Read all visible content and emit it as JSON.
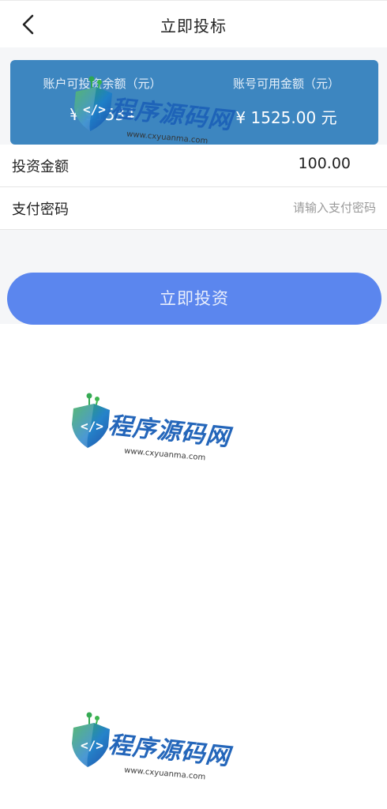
{
  "nav": {
    "title": "立即投标",
    "back_icon": "chevron-left-icon"
  },
  "balance_card": {
    "bg_color": "#3d86c0",
    "left": {
      "label": "账户可投资余额（元）",
      "value": "¥ 91534"
    },
    "right": {
      "label": "账号可用金额（元）",
      "value": "¥ 1525.00 元"
    }
  },
  "form": {
    "amount": {
      "label": "投资金额",
      "value": "100.00"
    },
    "password": {
      "label": "支付密码",
      "placeholder": "请输入支付密码"
    }
  },
  "submit": {
    "label": "立即投资",
    "color": "#5b86ee"
  },
  "watermark": {
    "brand": "程序源码网",
    "url": "www.cxyuanma.com",
    "icon": "code-shield-icon"
  }
}
